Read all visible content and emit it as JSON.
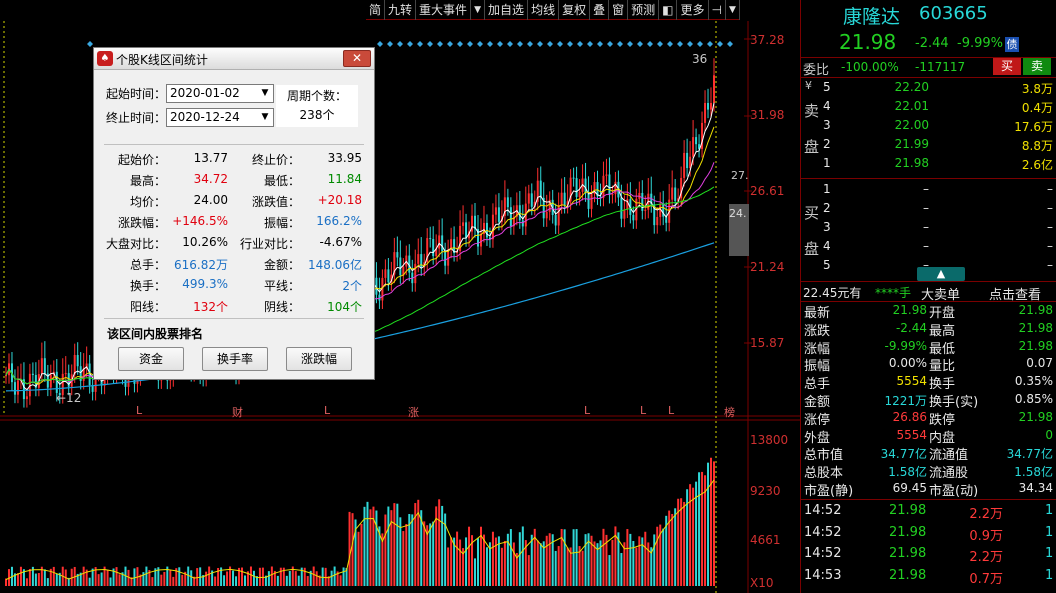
{
  "toolbar": {
    "items": [
      "简",
      "九转",
      "重大事件",
      "▼",
      "加自选",
      "均线",
      "复权",
      "叠",
      "窗",
      "预测",
      "◧",
      "更多",
      "⊣",
      "▼"
    ]
  },
  "chart": {
    "price_axis": [
      "37.28",
      "31.98",
      "26.61",
      "21.24",
      "15.87"
    ],
    "volume_axis": [
      "13800",
      "9230",
      "4661",
      "X10"
    ],
    "marker_high": "36",
    "marker_low": "←12",
    "marker_right_top": "27.",
    "marker_right_box": "24.",
    "bottom_tags": [
      "L",
      "财",
      "L",
      "涨",
      "L",
      "L",
      "L",
      "榜"
    ]
  },
  "dialog": {
    "title": "个股K线区间统计",
    "close_label": "✕",
    "start_label": "起始时间：",
    "start_value": "2020-01-02",
    "end_label": "终止时间：",
    "end_value": "2020-12-24",
    "period_label": "周期个数：",
    "period_value": "238个",
    "stats": {
      "start_price_label": "起始价：",
      "start_price": "13.77",
      "end_price_label": "终止价：",
      "end_price": "33.95",
      "high_label": "最高：",
      "high": "34.72",
      "low_label": "最低：",
      "low": "11.84",
      "avg_label": "均价：",
      "avg": "24.00",
      "change_value_label": "涨跌值：",
      "change_value": "+20.18",
      "change_pct_label": "涨跌幅：",
      "change_pct": "+146.5%",
      "amplitude_label": "振幅：",
      "amplitude": "166.2%",
      "market_label": "大盘对比：",
      "market": "10.26%",
      "industry_label": "行业对比：",
      "industry": "-4.67%",
      "volume_label": "总手：",
      "volume": "616.82万",
      "amount_label": "金额：",
      "amount": "148.06亿",
      "turnover_label": "换手：",
      "turnover": "499.3%",
      "flat_label": "平线：",
      "flat": "2个",
      "up_label": "阳线：",
      "up": "132个",
      "down_label": "阴线：",
      "down": "104个"
    },
    "rank_title": "该区间内股票排名",
    "buttons": [
      "资金",
      "换手率",
      "涨跌幅"
    ]
  },
  "panel": {
    "name": "康隆达",
    "code": "603665",
    "price": "21.98",
    "change": "-2.44",
    "change_pct": "-9.99%",
    "badge": "债",
    "weibi_label": "委比",
    "weibi_value": "-100.00%",
    "weicha_value": "-117117",
    "buy_btn": "买",
    "sell_btn": "卖",
    "sell_side_label": [
      "卖",
      "盘"
    ],
    "buy_side_label": [
      "买",
      "盘"
    ],
    "currency_mark": "¥",
    "asks": [
      {
        "level": "5",
        "price": "22.20",
        "vol": "3.8万"
      },
      {
        "level": "4",
        "price": "22.01",
        "vol": "0.4万"
      },
      {
        "level": "3",
        "price": "22.00",
        "vol": "17.6万"
      },
      {
        "level": "2",
        "price": "21.99",
        "vol": "8.8万"
      },
      {
        "level": "1",
        "price": "21.98",
        "vol": "2.6亿"
      }
    ],
    "bids": [
      {
        "level": "1",
        "price": "–",
        "vol": "–"
      },
      {
        "level": "2",
        "price": "–",
        "vol": "–"
      },
      {
        "level": "3",
        "price": "–",
        "vol": "–"
      },
      {
        "level": "4",
        "price": "–",
        "vol": "–"
      },
      {
        "level": "5",
        "price": "–",
        "vol": "–"
      }
    ],
    "big_order_price": "22.45元有",
    "big_order_mask": "****手",
    "big_order_label": "大卖单",
    "big_order_link": "点击查看",
    "quotes": [
      {
        "l1": "最新",
        "v1": "21.98",
        "c1": "pgreen",
        "l2": "开盘",
        "v2": "21.98",
        "c2": "pgreen"
      },
      {
        "l1": "涨跌",
        "v1": "-2.44",
        "c1": "pgreen",
        "l2": "最高",
        "v2": "21.98",
        "c2": "pgreen"
      },
      {
        "l1": "涨幅",
        "v1": "-9.99%",
        "c1": "pgreen",
        "l2": "最低",
        "v2": "21.98",
        "c2": "pgreen"
      },
      {
        "l1": "振幅",
        "v1": "0.00%",
        "c1": "white",
        "l2": "量比",
        "v2": "0.07",
        "c2": "white"
      },
      {
        "l1": "总手",
        "v1": "5554",
        "c1": "yellow",
        "l2": "换手",
        "v2": "0.35%",
        "c2": "white"
      },
      {
        "l1": "金额",
        "v1": "1221万",
        "c1": "cyan",
        "l2": "换手(实)",
        "v2": "0.85%",
        "c2": "white"
      },
      {
        "l1": "涨停",
        "v1": "26.86",
        "c1": "pred",
        "l2": "跌停",
        "v2": "21.98",
        "c2": "pgreen"
      },
      {
        "l1": "外盘",
        "v1": "5554",
        "c1": "pred",
        "l2": "内盘",
        "v2": "0",
        "c2": "pgreen"
      },
      {
        "l1": "总市值",
        "v1": "34.77亿",
        "c1": "cyan",
        "l2": "流通值",
        "v2": "34.77亿",
        "c2": "cyan"
      },
      {
        "l1": "总股本",
        "v1": "1.58亿",
        "c1": "cyan",
        "l2": "流通股",
        "v2": "1.58亿",
        "c2": "cyan"
      },
      {
        "l1": "市盈(静)",
        "v1": "69.45",
        "c1": "white",
        "l2": "市盈(动)",
        "v2": "34.34",
        "c2": "white"
      }
    ],
    "ticks": [
      {
        "time": "14:52",
        "price": "21.98",
        "vol": "2.2万",
        "n": "1"
      },
      {
        "time": "14:52",
        "price": "21.98",
        "vol": "0.9万",
        "n": "1"
      },
      {
        "time": "14:52",
        "price": "21.98",
        "vol": "2.2万",
        "n": "1"
      },
      {
        "time": "14:53",
        "price": "21.98",
        "vol": "0.7万",
        "n": "1"
      }
    ]
  }
}
